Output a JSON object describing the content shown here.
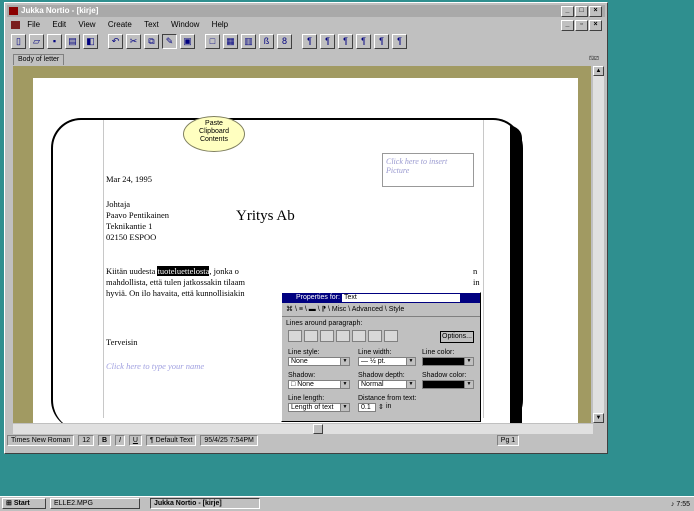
{
  "window": {
    "title": "Jukka Nortio - [kirje]"
  },
  "menu": {
    "items": [
      "File",
      "Edit",
      "View",
      "Create",
      "Text",
      "Window",
      "Help"
    ]
  },
  "toolbar": {
    "icons": [
      "new-doc-icon",
      "open-icon",
      "save-icon",
      "print-icon",
      "preview-icon",
      "undo-icon",
      "cut-icon",
      "copy-icon",
      "paste-icon",
      "clipboard-icon",
      "frame-icon",
      "table-icon",
      "chart-icon",
      "spell-icon",
      "find-icon",
      "style1-icon",
      "style2-icon",
      "style3-icon",
      "style4-icon",
      "style5-icon",
      "style6-icon"
    ],
    "tooltip": "Paste\nClipboard\nContents"
  },
  "tab": {
    "label": "Body of letter"
  },
  "document": {
    "picture_placeholder": "Click here to insert Picture",
    "company": "Yritys Ab",
    "date": "Mar 24, 1995",
    "recipient": [
      "Johtaja",
      "Paavo Pentikainen",
      "Teknikantie 1",
      "02150 ESPOO"
    ],
    "body_pre": "Kiitän uudesta ",
    "body_highlight": "tuoteluettelosta",
    "body_post": ", jonka o",
    "body_line2": "mahdollista, että tulen jatkossakin tilaam",
    "body_line3": "hyviä. On ilo havaita, että kunnollisiakin",
    "right_frag1": "n",
    "right_frag2": "in",
    "closing": "Terveisin",
    "name_placeholder": "Click here to type your name"
  },
  "properties": {
    "title_label": "Properties for:",
    "title_value": "Text",
    "tabs": "Misc \\ Advanced \\ Style",
    "lines_around": "Lines around paragraph:",
    "options_btn": "Options...",
    "line_style_label": "Line style:",
    "line_style_value": "None",
    "line_width_label": "Line width:",
    "line_width_value": "— ½ pt.",
    "line_color_label": "Line color:",
    "shadow_label": "Shadow:",
    "shadow_value": "None",
    "shadow_depth_label": "Shadow depth:",
    "shadow_depth_value": "Normal",
    "shadow_color_label": "Shadow color:",
    "line_length_label": "Line length:",
    "line_length_value": "Length of text",
    "distance_label": "Distance from text:",
    "distance_value": "0.1",
    "distance_unit": "in"
  },
  "status": {
    "font": "Times New Roman",
    "size": "12",
    "bold": "B",
    "italic": "I",
    "underline": "U",
    "style": "¶ Default Text",
    "datetime": "95/4/25  7:54PM",
    "page": "Pg 1"
  },
  "taskbar": {
    "start": "Start",
    "item1": "ELLE2.MPG",
    "item2": "Jukka Nortio - [kirje]",
    "clock": "7:55"
  }
}
